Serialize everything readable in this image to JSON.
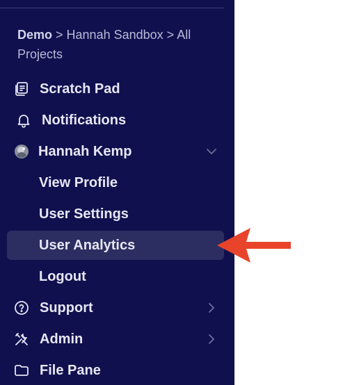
{
  "breadcrumb": {
    "workspace": "Demo",
    "separator1": " > ",
    "sandbox": "Hannah Sandbox",
    "separator2": " > ",
    "projects": "All Projects"
  },
  "nav": {
    "scratch_pad": "Scratch Pad",
    "notifications": "Notifications",
    "user_name": "Hannah Kemp",
    "view_profile": "View Profile",
    "user_settings": "User Settings",
    "user_analytics": "User Analytics",
    "logout": "Logout",
    "support": "Support",
    "admin": "Admin",
    "file_pane": "File Pane"
  },
  "colors": {
    "sidebar_bg": "#10104f",
    "active_bg": "#2c2e62",
    "arrow": "#e8442b"
  },
  "icons": {
    "scratch_pad": "scratch-pad-icon",
    "notifications": "bell-icon",
    "user": "avatar",
    "support": "help-circle-icon",
    "admin": "tools-icon",
    "file_pane": "folder-icon"
  }
}
